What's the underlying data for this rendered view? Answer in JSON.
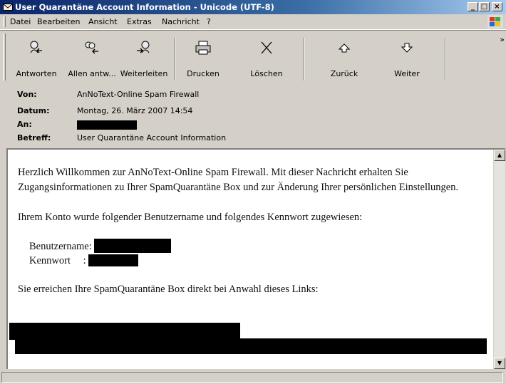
{
  "window": {
    "title": "User Quarantäne Account Information - Unicode (UTF-8)",
    "controls": {
      "minimize": "_",
      "maximize": "□",
      "close": "×"
    }
  },
  "menu": {
    "items": [
      {
        "label": "Datei"
      },
      {
        "label": "Bearbeiten"
      },
      {
        "label": "Ansicht"
      },
      {
        "label": "Extras"
      },
      {
        "label": "Nachricht"
      },
      {
        "label": "?"
      }
    ]
  },
  "toolbar": {
    "buttons": [
      {
        "label": "Antworten",
        "icon": "reply-icon"
      },
      {
        "label": "Allen antw...",
        "icon": "reply-all-icon"
      },
      {
        "label": "Weiterleiten",
        "icon": "forward-icon"
      },
      {
        "label": "Drucken",
        "icon": "printer-icon"
      },
      {
        "label": "Löschen",
        "icon": "delete-icon"
      },
      {
        "label": "Zurück",
        "icon": "previous-icon"
      },
      {
        "label": "Weiter",
        "icon": "next-icon"
      }
    ],
    "overflow": "»"
  },
  "header": {
    "from": {
      "label": "Von:",
      "value": "AnNoText-Online Spam Firewall"
    },
    "date": {
      "label": "Datum:",
      "value": "Montag, 26. März 2007 14:54"
    },
    "to": {
      "label": "An:",
      "value": ""
    },
    "subject": {
      "label": "Betreff:",
      "value": "User Quarantäne Account Information"
    }
  },
  "message": {
    "intro": "Herzlich Willkommen zur AnNoText-Online Spam Firewall.  Mit dieser Nachricht erhalten Sie Zugangsinformationen zu Ihrer SpamQuarantäne Box und zur Änderung Ihrer persönlichen Einstellungen.",
    "account_line": "Ihrem Konto wurde folgender Benutzername und folgendes Kennwort zugewiesen:",
    "username_label": "Benutzername:",
    "password_label": "Kennwort",
    "password_sep": ":",
    "link_line": "Sie erreichen Ihre SpamQuarantäne Box direkt bei Anwahl dieses Links:"
  },
  "colors": {
    "title_start": "#0a246a",
    "title_end": "#a6caf0",
    "chrome": "#d4d0c8"
  }
}
